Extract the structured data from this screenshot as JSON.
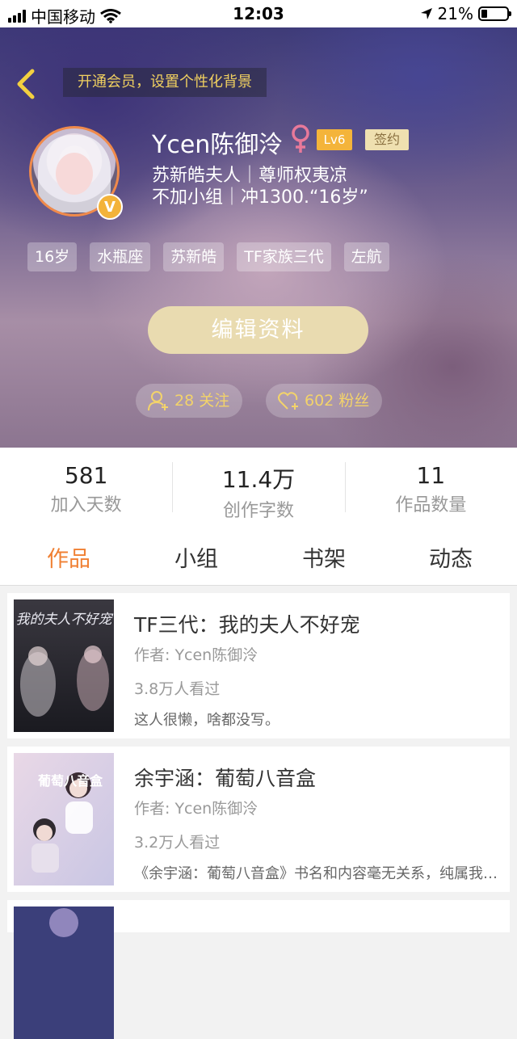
{
  "status_bar": {
    "carrier": "中国移动",
    "time": "12:03",
    "battery": "21%"
  },
  "header": {
    "vip_banner": "开通会员，设置个性化背景",
    "username": "Ycen陈御泠",
    "level": "Lv6",
    "signed_badge": "签约",
    "bio_line1": "苏新皓夫人｜尊师权夷凉",
    "bio_line2": "不加小组｜冲1300.“16岁”",
    "tags": [
      "16岁",
      "水瓶座",
      "苏新皓",
      "TF家族三代",
      "左航"
    ],
    "edit_button": "编辑资料",
    "follow_label": "28 关注",
    "fans_label": "602 粉丝",
    "accent_color": "#f3b33a",
    "gender": "female"
  },
  "stats": [
    {
      "value": "581",
      "label": "加入天数"
    },
    {
      "value": "11.4万",
      "label": "创作字数"
    },
    {
      "value": "11",
      "label": "作品数量"
    }
  ],
  "tabs": [
    {
      "label": "作品",
      "active": true
    },
    {
      "label": "小组",
      "active": false
    },
    {
      "label": "书架",
      "active": false
    },
    {
      "label": "动态",
      "active": false
    }
  ],
  "books": [
    {
      "title": "TF三代：我的夫人不好宠",
      "author": "作者: Ycen陈御泠",
      "reads": "3.8万人看过",
      "desc": "这人很懒，啥都没写。",
      "cover_text": "我的夫人不好宠"
    },
    {
      "title": "余宇涵：葡萄八音盒",
      "author": "作者: Ycen陈御泠",
      "reads": "3.2万人看过",
      "desc": "《余宇涵：葡萄八音盒》书名和内容毫无关系，纯属我…",
      "cover_text": "葡萄八音盒"
    }
  ]
}
